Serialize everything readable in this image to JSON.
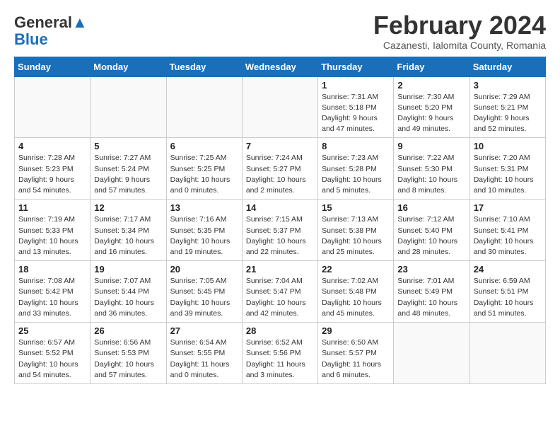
{
  "header": {
    "logo_general": "General",
    "logo_blue": "Blue",
    "month_title": "February 2024",
    "subtitle": "Cazanesti, Ialomita County, Romania"
  },
  "days_of_week": [
    "Sunday",
    "Monday",
    "Tuesday",
    "Wednesday",
    "Thursday",
    "Friday",
    "Saturday"
  ],
  "weeks": [
    [
      {
        "day": "",
        "info": ""
      },
      {
        "day": "",
        "info": ""
      },
      {
        "day": "",
        "info": ""
      },
      {
        "day": "",
        "info": ""
      },
      {
        "day": "1",
        "info": "Sunrise: 7:31 AM\nSunset: 5:18 PM\nDaylight: 9 hours\nand 47 minutes."
      },
      {
        "day": "2",
        "info": "Sunrise: 7:30 AM\nSunset: 5:20 PM\nDaylight: 9 hours\nand 49 minutes."
      },
      {
        "day": "3",
        "info": "Sunrise: 7:29 AM\nSunset: 5:21 PM\nDaylight: 9 hours\nand 52 minutes."
      }
    ],
    [
      {
        "day": "4",
        "info": "Sunrise: 7:28 AM\nSunset: 5:23 PM\nDaylight: 9 hours\nand 54 minutes."
      },
      {
        "day": "5",
        "info": "Sunrise: 7:27 AM\nSunset: 5:24 PM\nDaylight: 9 hours\nand 57 minutes."
      },
      {
        "day": "6",
        "info": "Sunrise: 7:25 AM\nSunset: 5:25 PM\nDaylight: 10 hours\nand 0 minutes."
      },
      {
        "day": "7",
        "info": "Sunrise: 7:24 AM\nSunset: 5:27 PM\nDaylight: 10 hours\nand 2 minutes."
      },
      {
        "day": "8",
        "info": "Sunrise: 7:23 AM\nSunset: 5:28 PM\nDaylight: 10 hours\nand 5 minutes."
      },
      {
        "day": "9",
        "info": "Sunrise: 7:22 AM\nSunset: 5:30 PM\nDaylight: 10 hours\nand 8 minutes."
      },
      {
        "day": "10",
        "info": "Sunrise: 7:20 AM\nSunset: 5:31 PM\nDaylight: 10 hours\nand 10 minutes."
      }
    ],
    [
      {
        "day": "11",
        "info": "Sunrise: 7:19 AM\nSunset: 5:33 PM\nDaylight: 10 hours\nand 13 minutes."
      },
      {
        "day": "12",
        "info": "Sunrise: 7:17 AM\nSunset: 5:34 PM\nDaylight: 10 hours\nand 16 minutes."
      },
      {
        "day": "13",
        "info": "Sunrise: 7:16 AM\nSunset: 5:35 PM\nDaylight: 10 hours\nand 19 minutes."
      },
      {
        "day": "14",
        "info": "Sunrise: 7:15 AM\nSunset: 5:37 PM\nDaylight: 10 hours\nand 22 minutes."
      },
      {
        "day": "15",
        "info": "Sunrise: 7:13 AM\nSunset: 5:38 PM\nDaylight: 10 hours\nand 25 minutes."
      },
      {
        "day": "16",
        "info": "Sunrise: 7:12 AM\nSunset: 5:40 PM\nDaylight: 10 hours\nand 28 minutes."
      },
      {
        "day": "17",
        "info": "Sunrise: 7:10 AM\nSunset: 5:41 PM\nDaylight: 10 hours\nand 30 minutes."
      }
    ],
    [
      {
        "day": "18",
        "info": "Sunrise: 7:08 AM\nSunset: 5:42 PM\nDaylight: 10 hours\nand 33 minutes."
      },
      {
        "day": "19",
        "info": "Sunrise: 7:07 AM\nSunset: 5:44 PM\nDaylight: 10 hours\nand 36 minutes."
      },
      {
        "day": "20",
        "info": "Sunrise: 7:05 AM\nSunset: 5:45 PM\nDaylight: 10 hours\nand 39 minutes."
      },
      {
        "day": "21",
        "info": "Sunrise: 7:04 AM\nSunset: 5:47 PM\nDaylight: 10 hours\nand 42 minutes."
      },
      {
        "day": "22",
        "info": "Sunrise: 7:02 AM\nSunset: 5:48 PM\nDaylight: 10 hours\nand 45 minutes."
      },
      {
        "day": "23",
        "info": "Sunrise: 7:01 AM\nSunset: 5:49 PM\nDaylight: 10 hours\nand 48 minutes."
      },
      {
        "day": "24",
        "info": "Sunrise: 6:59 AM\nSunset: 5:51 PM\nDaylight: 10 hours\nand 51 minutes."
      }
    ],
    [
      {
        "day": "25",
        "info": "Sunrise: 6:57 AM\nSunset: 5:52 PM\nDaylight: 10 hours\nand 54 minutes."
      },
      {
        "day": "26",
        "info": "Sunrise: 6:56 AM\nSunset: 5:53 PM\nDaylight: 10 hours\nand 57 minutes."
      },
      {
        "day": "27",
        "info": "Sunrise: 6:54 AM\nSunset: 5:55 PM\nDaylight: 11 hours\nand 0 minutes."
      },
      {
        "day": "28",
        "info": "Sunrise: 6:52 AM\nSunset: 5:56 PM\nDaylight: 11 hours\nand 3 minutes."
      },
      {
        "day": "29",
        "info": "Sunrise: 6:50 AM\nSunset: 5:57 PM\nDaylight: 11 hours\nand 6 minutes."
      },
      {
        "day": "",
        "info": ""
      },
      {
        "day": "",
        "info": ""
      }
    ]
  ]
}
